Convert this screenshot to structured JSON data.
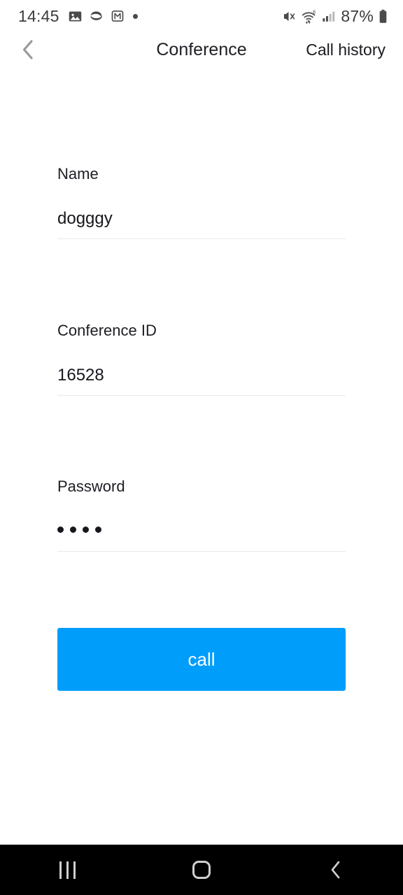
{
  "status_bar": {
    "time": "14:45",
    "battery_percent": "87%",
    "left_icons": [
      "gallery-icon",
      "shell-icon",
      "boxed-m-icon",
      "dot-indicator"
    ],
    "right_icons": [
      "mute-vibrate-icon",
      "wifi-6-icon",
      "cellular-signal-icon",
      "battery-icon"
    ],
    "text_color": "#3c3c3c"
  },
  "header": {
    "back_icon": "chevron-left-icon",
    "title": "Conference",
    "call_history_label": "Call history"
  },
  "form": {
    "fields": [
      {
        "label": "Name",
        "value": "dogggy",
        "masked": false,
        "placeholder": "Name"
      },
      {
        "label": "Conference ID",
        "value": "16528",
        "masked": false,
        "placeholder": "Conference ID"
      },
      {
        "label": "Password",
        "value": "••••",
        "masked": true,
        "mask_count": 4,
        "placeholder": "Password"
      }
    ]
  },
  "call_button": {
    "label": "call",
    "color": "#019dfb",
    "text_color": "#ffffff"
  },
  "nav_bar": {
    "background": "#000000",
    "buttons": [
      {
        "name": "recents-button",
        "icon": "recents-icon"
      },
      {
        "name": "home-button",
        "icon": "home-icon"
      },
      {
        "name": "back-button",
        "icon": "chevron-left-icon"
      }
    ]
  }
}
